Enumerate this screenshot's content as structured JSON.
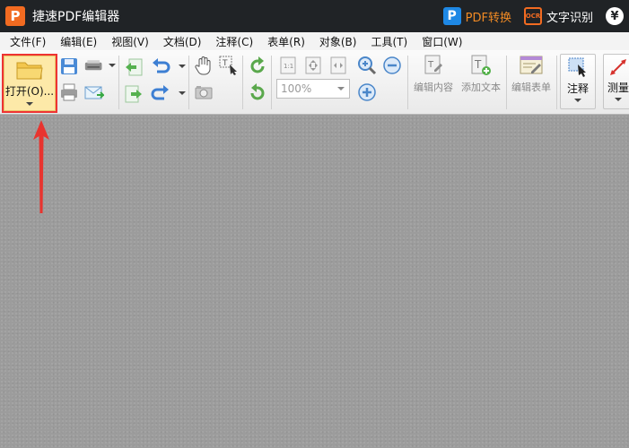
{
  "app": {
    "logo_letter": "P",
    "title": "捷速PDF编辑器"
  },
  "title_actions": {
    "pdf_convert_icon_letter": "P",
    "pdf_convert_label": "PDF转换",
    "ocr_icon_text": "OCR",
    "ocr_label": "文字识别",
    "yen_symbol": "¥"
  },
  "menu": [
    {
      "label": "文件(F)"
    },
    {
      "label": "编辑(E)"
    },
    {
      "label": "视图(V)"
    },
    {
      "label": "文档(D)"
    },
    {
      "label": "注释(C)"
    },
    {
      "label": "表单(R)"
    },
    {
      "label": "对象(B)"
    },
    {
      "label": "工具(T)"
    },
    {
      "label": "窗口(W)"
    }
  ],
  "toolbar": {
    "open_label": "打开(O)...",
    "zoom_value": "100%",
    "edit_content_label": "编辑内容",
    "add_text_label": "添加文本",
    "edit_form_label": "编辑表单",
    "annotate_label": "注释",
    "measure_label": "测量"
  },
  "colors": {
    "title_bar": "#202326",
    "accent_orange": "#f26b21",
    "pdf_convert_text": "#f08a24",
    "highlight_red": "#e33333",
    "canvas": "#9c9c9c"
  }
}
